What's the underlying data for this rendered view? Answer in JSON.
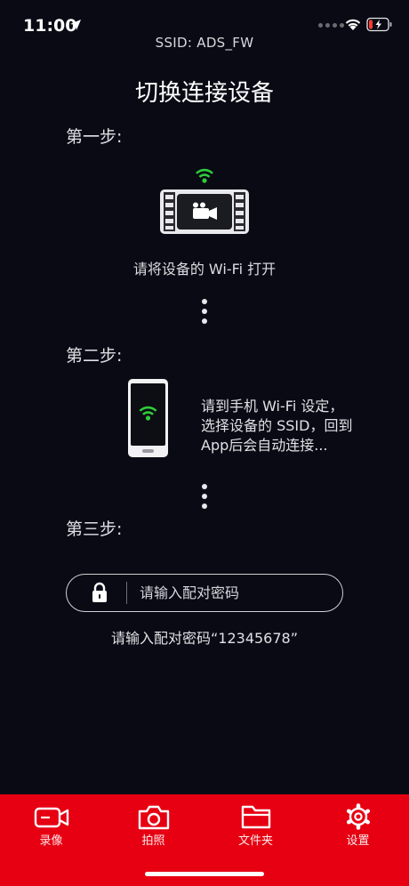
{
  "status_bar": {
    "time": "11:00",
    "icons": [
      "location-arrow-icon",
      "signal-dots-icon",
      "wifi-icon",
      "battery-low-icon"
    ],
    "battery_color": "#ff3b30"
  },
  "header": {
    "ssid": "SSID: ADS_FW",
    "title": "切换连接设备"
  },
  "steps": [
    {
      "label": "第一步:",
      "caption": "请将设备的 Wi-Fi 打开",
      "icon": "camera-device-wifi-icon"
    },
    {
      "label": "第二步:",
      "lines": [
        "请到手机 Wi-Fi 设定，",
        "选择设备的 SSID，回到",
        "App后会自动连接..."
      ],
      "icon": "phone-wifi-icon"
    },
    {
      "label": "第三步:"
    }
  ],
  "password": {
    "placeholder": "请输入配对密码",
    "value": "",
    "hint": "请输入配对密码“12345678”",
    "icon": "lock-icon"
  },
  "tab_bar": {
    "background": "#e60012",
    "items": [
      {
        "label": "录像",
        "icon": "video-camera-icon"
      },
      {
        "label": "拍照",
        "icon": "camera-icon"
      },
      {
        "label": "文件夹",
        "icon": "folder-icon"
      },
      {
        "label": "设置",
        "icon": "gear-icon"
      }
    ]
  },
  "colors": {
    "background": "#090a14",
    "wifi_green": "#2ecc3a"
  }
}
